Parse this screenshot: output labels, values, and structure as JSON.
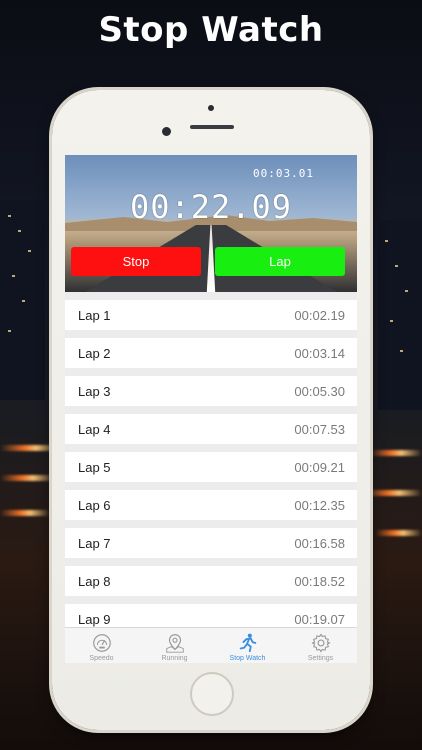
{
  "headline": "Stop Watch",
  "stopwatch": {
    "small_time": "00:03.01",
    "main_time": "00:22.09",
    "stop_label": "Stop",
    "lap_label": "Lap"
  },
  "laps": [
    {
      "label": "Lap 1",
      "time": "00:02.19"
    },
    {
      "label": "Lap 2",
      "time": "00:03.14"
    },
    {
      "label": "Lap 3",
      "time": "00:05.30"
    },
    {
      "label": "Lap 4",
      "time": "00:07.53"
    },
    {
      "label": "Lap 5",
      "time": "00:09.21"
    },
    {
      "label": "Lap 6",
      "time": "00:12.35"
    },
    {
      "label": "Lap 7",
      "time": "00:16.58"
    },
    {
      "label": "Lap 8",
      "time": "00:18.52"
    },
    {
      "label": "Lap 9",
      "time": "00:19.07"
    }
  ],
  "tabs": [
    {
      "label": "Speedo",
      "icon": "speedometer-icon"
    },
    {
      "label": "Running",
      "icon": "map-pin-icon"
    },
    {
      "label": "Stop Watch",
      "icon": "running-person-icon"
    },
    {
      "label": "Settings",
      "icon": "gear-icon"
    }
  ],
  "colors": {
    "stop": "#ff1010",
    "lap": "#18ee10",
    "active_tab": "#3b8fe0"
  }
}
